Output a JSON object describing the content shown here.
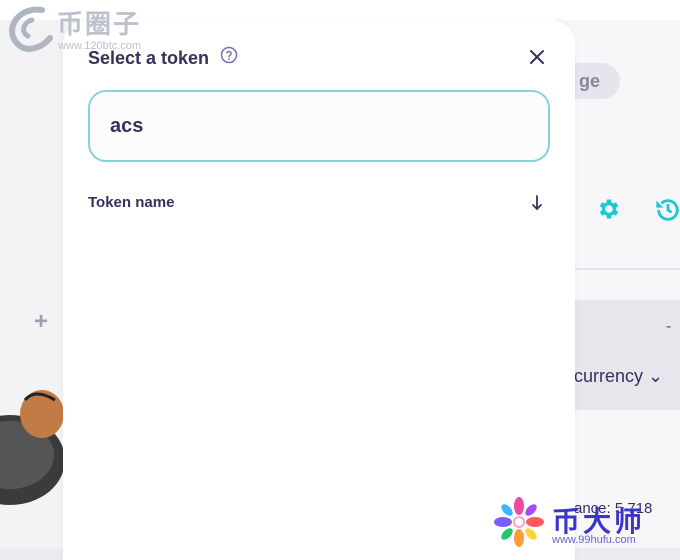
{
  "modal": {
    "title": "Select a token",
    "search_value": "acs",
    "column_header": "Token name"
  },
  "background": {
    "pill_label": "ge",
    "dash": "-",
    "currency_label": "currency",
    "balance_label": "ance: 5 718"
  },
  "watermarks": {
    "left_title": "币圈子",
    "left_url": "www.120btc.com",
    "right_title": "币大师",
    "right_url": "www.99hufu.com"
  },
  "icons": {
    "help": "help-circle-icon",
    "close": "close-icon",
    "sort": "arrow-down-icon",
    "gear": "gear-icon",
    "history": "history-icon",
    "plus": "plus-icon"
  },
  "colors": {
    "text_primary": "#3a2e5c",
    "search_border": "#89d1d8",
    "accent_teal": "#1fc7d4"
  }
}
